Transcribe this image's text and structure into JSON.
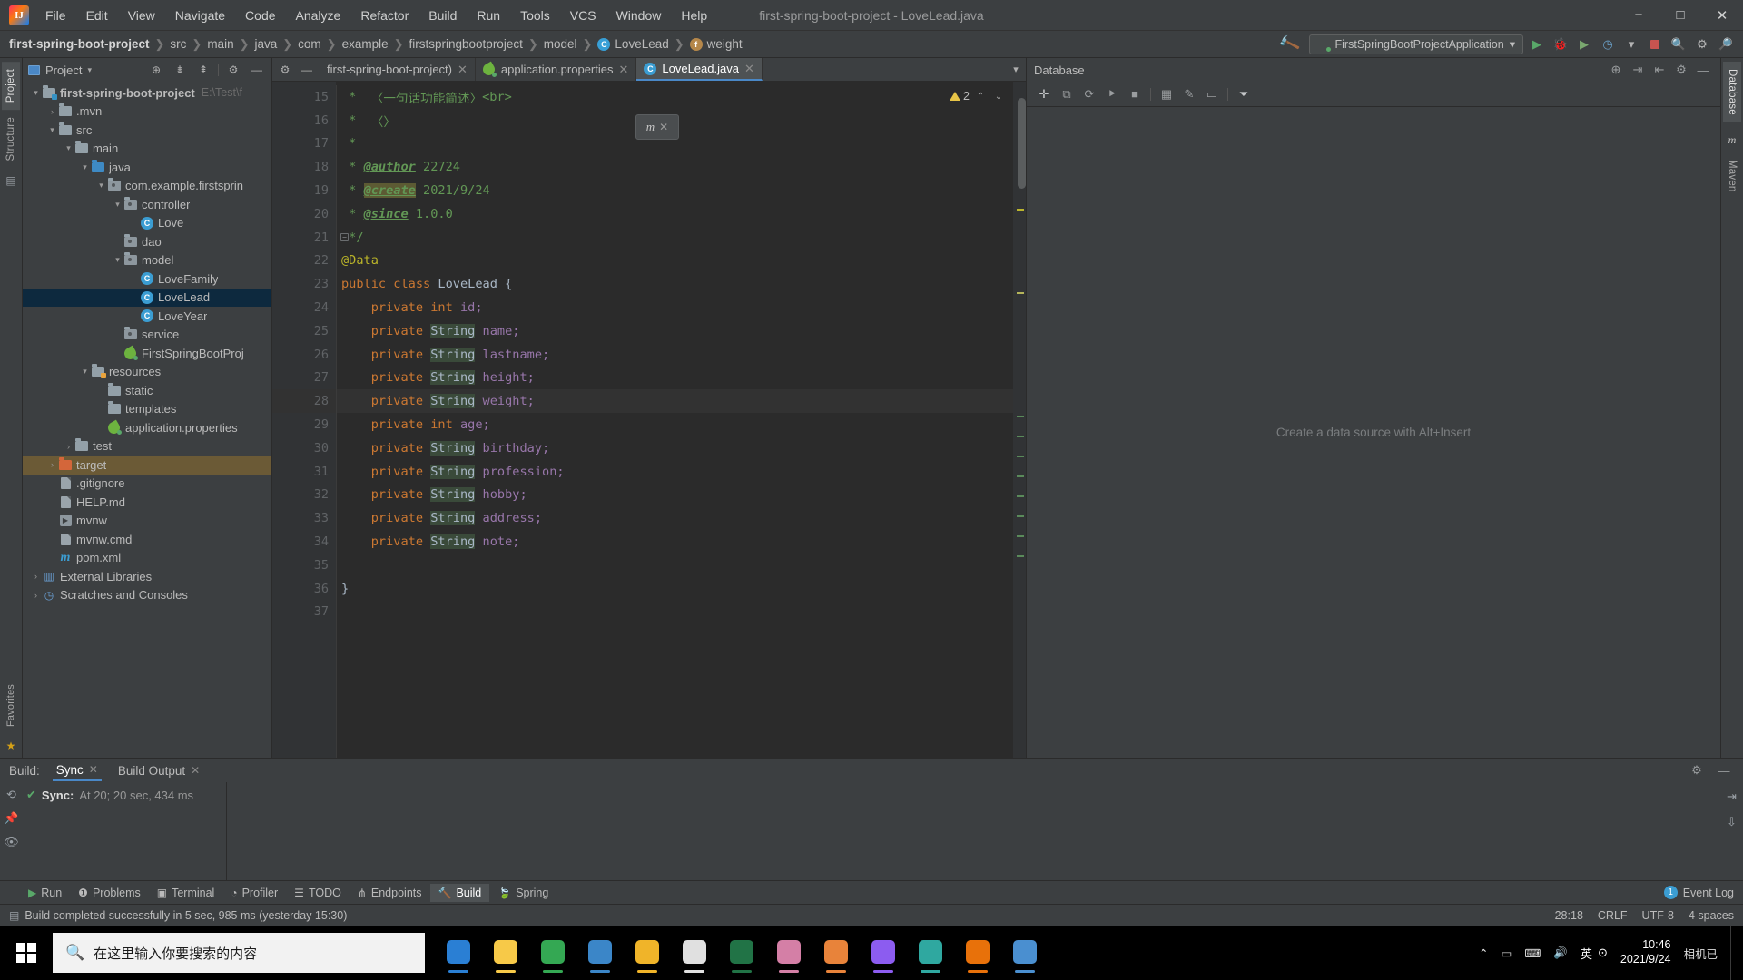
{
  "window": {
    "title": "first-spring-boot-project - LoveLead.java",
    "minimize": "−",
    "maximize": "□",
    "close": "✕"
  },
  "menu": {
    "items": [
      "File",
      "Edit",
      "View",
      "Navigate",
      "Code",
      "Analyze",
      "Refactor",
      "Build",
      "Run",
      "Tools",
      "VCS",
      "Window",
      "Help"
    ]
  },
  "breadcrumb": {
    "items": [
      {
        "label": "first-spring-boot-project",
        "icon": "",
        "bold": true
      },
      {
        "label": "src",
        "icon": ""
      },
      {
        "label": "main",
        "icon": ""
      },
      {
        "label": "java",
        "icon": ""
      },
      {
        "label": "com",
        "icon": ""
      },
      {
        "label": "example",
        "icon": ""
      },
      {
        "label": "firstspringbootproject",
        "icon": ""
      },
      {
        "label": "model",
        "icon": ""
      },
      {
        "label": "LoveLead",
        "icon": "class-icon",
        "glyph": "C"
      },
      {
        "label": "weight",
        "icon": "field-icon",
        "glyph": "f"
      }
    ],
    "separator": "❯"
  },
  "run_toolbar": {
    "build_icon": "build-hammer-icon",
    "config_name": "FirstSpringBootProjectApplication",
    "config_dropdown": "▾",
    "icons": [
      "run-icon",
      "debug-icon",
      "run-with-coverage-icon",
      "profile-icon",
      "dropdown-icon",
      "stop-icon",
      "search-everywhere-icon",
      "settings-icon",
      "search-icon"
    ]
  },
  "left_stripe": {
    "tabs": [
      "Project",
      "Structure"
    ],
    "icon": "bookmarks-icon"
  },
  "right_stripe": {
    "tabs": [
      "Database",
      "Maven"
    ]
  },
  "project_panel": {
    "title": "Project",
    "dropdown": "▾",
    "toolbar_icons": [
      "locate-icon",
      "expand-all-icon",
      "collapse-all-icon",
      "settings-icon",
      "hide-icon"
    ],
    "tree": [
      {
        "label": "first-spring-boot-project",
        "sub": "E:\\Test\\f",
        "depth": 0,
        "arrow": "▾",
        "icon": "folder-root",
        "bold": true
      },
      {
        "label": ".mvn",
        "depth": 1,
        "arrow": "›",
        "icon": "folder"
      },
      {
        "label": "src",
        "depth": 1,
        "arrow": "▾",
        "icon": "folder"
      },
      {
        "label": "main",
        "depth": 2,
        "arrow": "▾",
        "icon": "folder"
      },
      {
        "label": "java",
        "depth": 3,
        "arrow": "▾",
        "icon": "folder-blue"
      },
      {
        "label": "com.example.firstsprin",
        "depth": 4,
        "arrow": "▾",
        "icon": "folder-pkg"
      },
      {
        "label": "controller",
        "depth": 5,
        "arrow": "▾",
        "icon": "folder-pkg"
      },
      {
        "label": "Love",
        "depth": 6,
        "arrow": "",
        "icon": "class"
      },
      {
        "label": "dao",
        "depth": 5,
        "arrow": "",
        "icon": "folder-pkg"
      },
      {
        "label": "model",
        "depth": 5,
        "arrow": "▾",
        "icon": "folder-pkg"
      },
      {
        "label": "LoveFamily",
        "depth": 6,
        "arrow": "",
        "icon": "class"
      },
      {
        "label": "LoveLead",
        "depth": 6,
        "arrow": "",
        "icon": "class",
        "selected": true
      },
      {
        "label": "LoveYear",
        "depth": 6,
        "arrow": "",
        "icon": "class"
      },
      {
        "label": "service",
        "depth": 5,
        "arrow": "",
        "icon": "folder-pkg"
      },
      {
        "label": "FirstSpringBootProj",
        "depth": 5,
        "arrow": "",
        "icon": "spring"
      },
      {
        "label": "resources",
        "depth": 3,
        "arrow": "▾",
        "icon": "folder-res"
      },
      {
        "label": "static",
        "depth": 4,
        "arrow": "",
        "icon": "folder"
      },
      {
        "label": "templates",
        "depth": 4,
        "arrow": "",
        "icon": "folder"
      },
      {
        "label": "application.properties",
        "depth": 4,
        "arrow": "",
        "icon": "spring"
      },
      {
        "label": "test",
        "depth": 2,
        "arrow": "›",
        "icon": "folder"
      },
      {
        "label": "target",
        "depth": 1,
        "arrow": "›",
        "icon": "folder-orange",
        "highlight": true
      },
      {
        "label": ".gitignore",
        "depth": 1,
        "arrow": "",
        "icon": "file"
      },
      {
        "label": "HELP.md",
        "depth": 1,
        "arrow": "",
        "icon": "file"
      },
      {
        "label": "mvnw",
        "depth": 1,
        "arrow": "",
        "icon": "script"
      },
      {
        "label": "mvnw.cmd",
        "depth": 1,
        "arrow": "",
        "icon": "file"
      },
      {
        "label": "pom.xml",
        "depth": 1,
        "arrow": "",
        "icon": "maven"
      },
      {
        "label": "External Libraries",
        "depth": 0,
        "arrow": "›",
        "icon": "library"
      },
      {
        "label": "Scratches and Consoles",
        "depth": 0,
        "arrow": "›",
        "icon": "scratch"
      }
    ]
  },
  "editor": {
    "toolbar_icons": [
      "settings-icon",
      "hide-icon"
    ],
    "tabs": [
      {
        "label": "first-spring-boot-project)",
        "icon": "",
        "active": false,
        "close": "✕"
      },
      {
        "label": "application.properties",
        "icon": "spring-icon",
        "active": false,
        "close": "✕"
      },
      {
        "label": "LoveLead.java",
        "icon": "class-icon",
        "active": true,
        "close": "✕"
      }
    ],
    "tabs_overflow": "▾",
    "inspection": {
      "warning_count": "2",
      "up": "⌃",
      "down": "⌄"
    },
    "popup": {
      "label": "m",
      "close": "✕"
    },
    "first_line_number": 15,
    "lines": [
      {
        "n": 15,
        "tokens": [
          {
            "t": " *  ",
            "c": "cmt"
          },
          {
            "t": "〈一句话功能简述〉",
            "c": "cmt"
          },
          {
            "t": "<br>",
            "c": "cmt"
          }
        ]
      },
      {
        "n": 16,
        "tokens": [
          {
            "t": " *  ",
            "c": "cmt"
          },
          {
            "t": "〈〉",
            "c": "cmt"
          }
        ]
      },
      {
        "n": 17,
        "tokens": [
          {
            "t": " *",
            "c": "cmt"
          }
        ]
      },
      {
        "n": 18,
        "tokens": [
          {
            "t": " * ",
            "c": "cmt"
          },
          {
            "t": "@author",
            "c": "cmt-tag"
          },
          {
            "t": " 22724",
            "c": "cmt"
          }
        ]
      },
      {
        "n": 19,
        "tokens": [
          {
            "t": " * ",
            "c": "cmt"
          },
          {
            "t": "@create",
            "c": "cmt-tag cmt-hl"
          },
          {
            "t": " 2021/9/24",
            "c": "cmt"
          }
        ]
      },
      {
        "n": 20,
        "tokens": [
          {
            "t": " * ",
            "c": "cmt"
          },
          {
            "t": "@since",
            "c": "cmt-tag"
          },
          {
            "t": " 1.0.0",
            "c": "cmt"
          }
        ]
      },
      {
        "n": 21,
        "fold": true,
        "tokens": [
          {
            "t": " */",
            "c": "cmt"
          }
        ]
      },
      {
        "n": 22,
        "tokens": [
          {
            "t": "@Data",
            "c": "ann"
          }
        ]
      },
      {
        "n": 23,
        "tokens": [
          {
            "t": "public class ",
            "c": "kw"
          },
          {
            "t": "LoveLead",
            "c": "plain"
          },
          {
            "t": " {",
            "c": "plain"
          }
        ]
      },
      {
        "n": 24,
        "tokens": [
          {
            "t": "    ",
            "c": "plain"
          },
          {
            "t": "private int ",
            "c": "kw"
          },
          {
            "t": "id;",
            "c": "fld"
          }
        ]
      },
      {
        "n": 25,
        "tokens": [
          {
            "t": "    ",
            "c": "plain"
          },
          {
            "t": "private ",
            "c": "kw"
          },
          {
            "t": "String",
            "c": "typ str-hl"
          },
          {
            "t": " ",
            "c": "plain"
          },
          {
            "t": "name;",
            "c": "fld"
          }
        ]
      },
      {
        "n": 26,
        "tokens": [
          {
            "t": "    ",
            "c": "plain"
          },
          {
            "t": "private ",
            "c": "kw"
          },
          {
            "t": "String",
            "c": "typ str-hl"
          },
          {
            "t": " ",
            "c": "plain"
          },
          {
            "t": "lastname;",
            "c": "fld"
          }
        ]
      },
      {
        "n": 27,
        "tokens": [
          {
            "t": "    ",
            "c": "plain"
          },
          {
            "t": "private ",
            "c": "kw"
          },
          {
            "t": "String",
            "c": "typ str-hl"
          },
          {
            "t": " ",
            "c": "plain"
          },
          {
            "t": "height;",
            "c": "fld"
          }
        ]
      },
      {
        "n": 28,
        "bulb": true,
        "hl": true,
        "tokens": [
          {
            "t": "    ",
            "c": "plain"
          },
          {
            "t": "private ",
            "c": "kw"
          },
          {
            "t": "String",
            "c": "typ str-hl"
          },
          {
            "t": " ",
            "c": "plain"
          },
          {
            "t": "weight;",
            "c": "fld"
          }
        ]
      },
      {
        "n": 29,
        "tokens": [
          {
            "t": "    ",
            "c": "plain"
          },
          {
            "t": "private int ",
            "c": "kw"
          },
          {
            "t": "age;",
            "c": "fld"
          }
        ]
      },
      {
        "n": 30,
        "tokens": [
          {
            "t": "    ",
            "c": "plain"
          },
          {
            "t": "private ",
            "c": "kw"
          },
          {
            "t": "String",
            "c": "typ str-hl"
          },
          {
            "t": " ",
            "c": "plain"
          },
          {
            "t": "birthday;",
            "c": "fld"
          }
        ]
      },
      {
        "n": 31,
        "tokens": [
          {
            "t": "    ",
            "c": "plain"
          },
          {
            "t": "private ",
            "c": "kw"
          },
          {
            "t": "String",
            "c": "typ str-hl"
          },
          {
            "t": " ",
            "c": "plain"
          },
          {
            "t": "profession;",
            "c": "fld"
          }
        ]
      },
      {
        "n": 32,
        "tokens": [
          {
            "t": "    ",
            "c": "plain"
          },
          {
            "t": "private ",
            "c": "kw"
          },
          {
            "t": "String",
            "c": "typ str-hl"
          },
          {
            "t": " ",
            "c": "plain"
          },
          {
            "t": "hobby;",
            "c": "fld"
          }
        ]
      },
      {
        "n": 33,
        "tokens": [
          {
            "t": "    ",
            "c": "plain"
          },
          {
            "t": "private ",
            "c": "kw"
          },
          {
            "t": "String",
            "c": "typ str-hl"
          },
          {
            "t": " ",
            "c": "plain"
          },
          {
            "t": "address;",
            "c": "fld"
          }
        ]
      },
      {
        "n": 34,
        "tokens": [
          {
            "t": "    ",
            "c": "plain"
          },
          {
            "t": "private ",
            "c": "kw"
          },
          {
            "t": "String",
            "c": "typ str-hl"
          },
          {
            "t": " ",
            "c": "plain"
          },
          {
            "t": "note;",
            "c": "fld"
          }
        ]
      },
      {
        "n": 35,
        "tokens": []
      },
      {
        "n": 36,
        "tokens": [
          {
            "t": "}",
            "c": "plain"
          }
        ]
      },
      {
        "n": 37,
        "tokens": []
      }
    ]
  },
  "database_panel": {
    "title": "Database",
    "toolbar_icons": [
      "add-icon",
      "copy-icon",
      "refresh-icon",
      "run-sql-icon",
      "stop-icon",
      "table-icon",
      "edit-icon",
      "console-icon",
      "filter-icon"
    ],
    "header_icons": [
      "help-icon",
      "expand-icon",
      "collapse-icon",
      "settings-icon",
      "hide-icon"
    ],
    "empty_message": "Create a data source with Alt+Insert"
  },
  "build_window": {
    "label": "Build:",
    "tabs": [
      {
        "label": "Sync",
        "active": true,
        "close": "✕"
      },
      {
        "label": "Build Output",
        "active": false,
        "close": "✕"
      }
    ],
    "side_icons": [
      "rerun-icon",
      "pin-icon",
      "eye-icon"
    ],
    "entry": {
      "check": "✔",
      "title": "Sync:",
      "detail": "At 20; 20 sec, 434 ms"
    },
    "right_icons": [
      "settings-icon",
      "hide-icon"
    ],
    "far_icons": [
      "wrap-icon",
      "scroll-icon"
    ]
  },
  "bottom_toolbar": {
    "tabs": [
      {
        "label": "Run",
        "icon": "run-icon",
        "active": false
      },
      {
        "label": "Problems",
        "icon": "problems-icon",
        "active": false
      },
      {
        "label": "Terminal",
        "icon": "terminal-icon",
        "active": false
      },
      {
        "label": "Profiler",
        "icon": "profiler-icon",
        "active": false
      },
      {
        "label": "TODO",
        "icon": "todo-icon",
        "active": false
      },
      {
        "label": "Endpoints",
        "icon": "endpoints-icon",
        "active": false
      },
      {
        "label": "Build",
        "icon": "build-icon",
        "active": true
      },
      {
        "label": "Spring",
        "icon": "spring-icon",
        "active": false
      }
    ],
    "event_log": {
      "count": "1",
      "label": "Event Log"
    }
  },
  "status_bar": {
    "message": "Build completed successfully in 5 sec, 985 ms (yesterday 15:30)",
    "icon": "build-status-icon",
    "caret": "28:18",
    "line_sep": "CRLF",
    "encoding": "UTF-8",
    "indent": "4 spaces"
  },
  "taskbar": {
    "start": "windows-start-icon",
    "search_placeholder": "在这里输入你要搜索的内容",
    "search_icon": "search-icon",
    "apps": [
      {
        "name": "edge-legacy-icon",
        "color": "#2a7fd4"
      },
      {
        "name": "qq-music-icon",
        "color": "#f7c948"
      },
      {
        "name": "chrome-icon",
        "color": "#34a853"
      },
      {
        "name": "edge-icon",
        "color": "#3b86c8"
      },
      {
        "name": "file-explorer-icon",
        "color": "#f0b429"
      },
      {
        "name": "typora-icon",
        "color": "#e0e0e0"
      },
      {
        "name": "excel-icon",
        "color": "#217346"
      },
      {
        "name": "photos-icon",
        "color": "#d47fa6"
      },
      {
        "name": "wechat-dev-icon",
        "color": "#e8833a"
      },
      {
        "name": "intellij-idea-icon",
        "color": "#8c5cf0"
      },
      {
        "name": "navicat-icon",
        "color": "#2fa8a0"
      },
      {
        "name": "firefox-icon",
        "color": "#e8710a"
      },
      {
        "name": "vscode-icon",
        "color": "#4a8fd0"
      }
    ],
    "tray": {
      "chevron": "⌃",
      "icons": [
        "battery-icon",
        "network-icon",
        "volume-icon",
        "ime-icon"
      ],
      "ime_label": "英",
      "clock_time": "10:46",
      "clock_date": "2021/9/24",
      "notification": "相机已"
    }
  }
}
